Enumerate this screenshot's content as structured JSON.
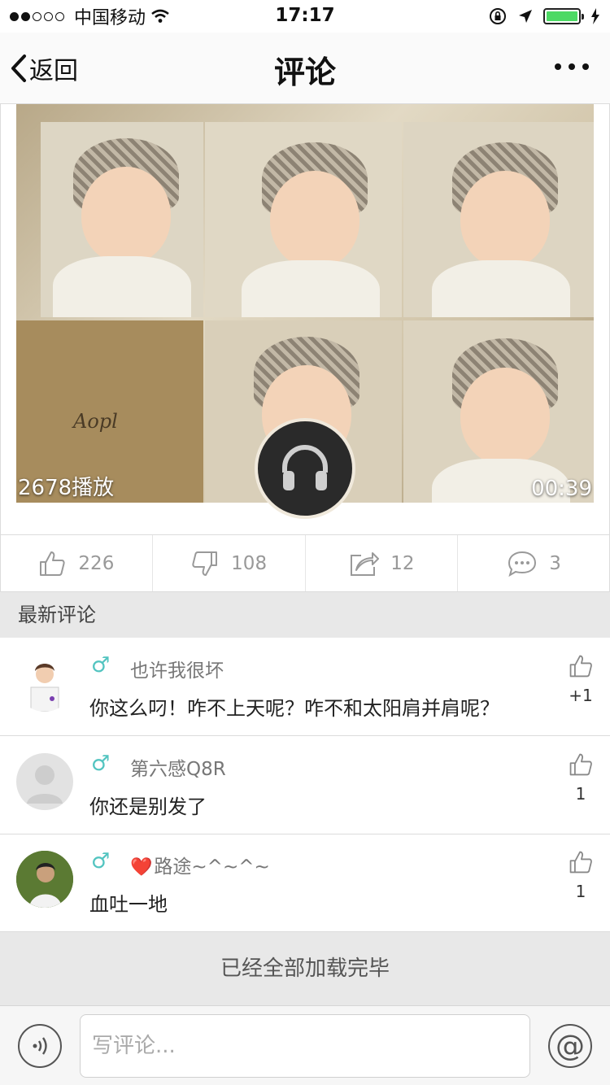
{
  "status_bar": {
    "carrier": "中国移动",
    "time": "17:17"
  },
  "nav": {
    "back_label": "返回",
    "title": "评论"
  },
  "video": {
    "plays": "2678播放",
    "duration": "00:39",
    "watermark": "Aopl"
  },
  "actions": {
    "likes": "226",
    "dislikes": "108",
    "shares": "12",
    "comments": "3"
  },
  "section": {
    "title": "最新评论"
  },
  "comments": [
    {
      "gender": "♂",
      "user": "也许我很坏",
      "text": "你这么叼！咋不上天呢？咋不和太阳肩并肩呢？",
      "likes": "+1"
    },
    {
      "gender": "♂",
      "user": "第六感Q8R",
      "text": "你还是别发了",
      "likes": "1"
    },
    {
      "gender": "♂",
      "user_prefix": "❤️",
      "user": "路途~^~^~",
      "text": "血吐一地",
      "likes": "1"
    }
  ],
  "footer": {
    "loaded_text": "已经全部加载完毕"
  },
  "input": {
    "placeholder": "写评论..."
  },
  "icons": {
    "back": "chevron-left-icon",
    "more": "more-dots-icon",
    "audio": "headphones-icon",
    "like": "thumbs-up-icon",
    "dislike": "thumbs-down-icon",
    "share": "share-icon",
    "comment": "comment-bubble-icon",
    "voice": "voice-icon",
    "at": "at-sign-icon"
  },
  "colors": {
    "gender": "#52c4c0",
    "battery": "#4cd964",
    "header_bg": "#e8e8e8"
  }
}
